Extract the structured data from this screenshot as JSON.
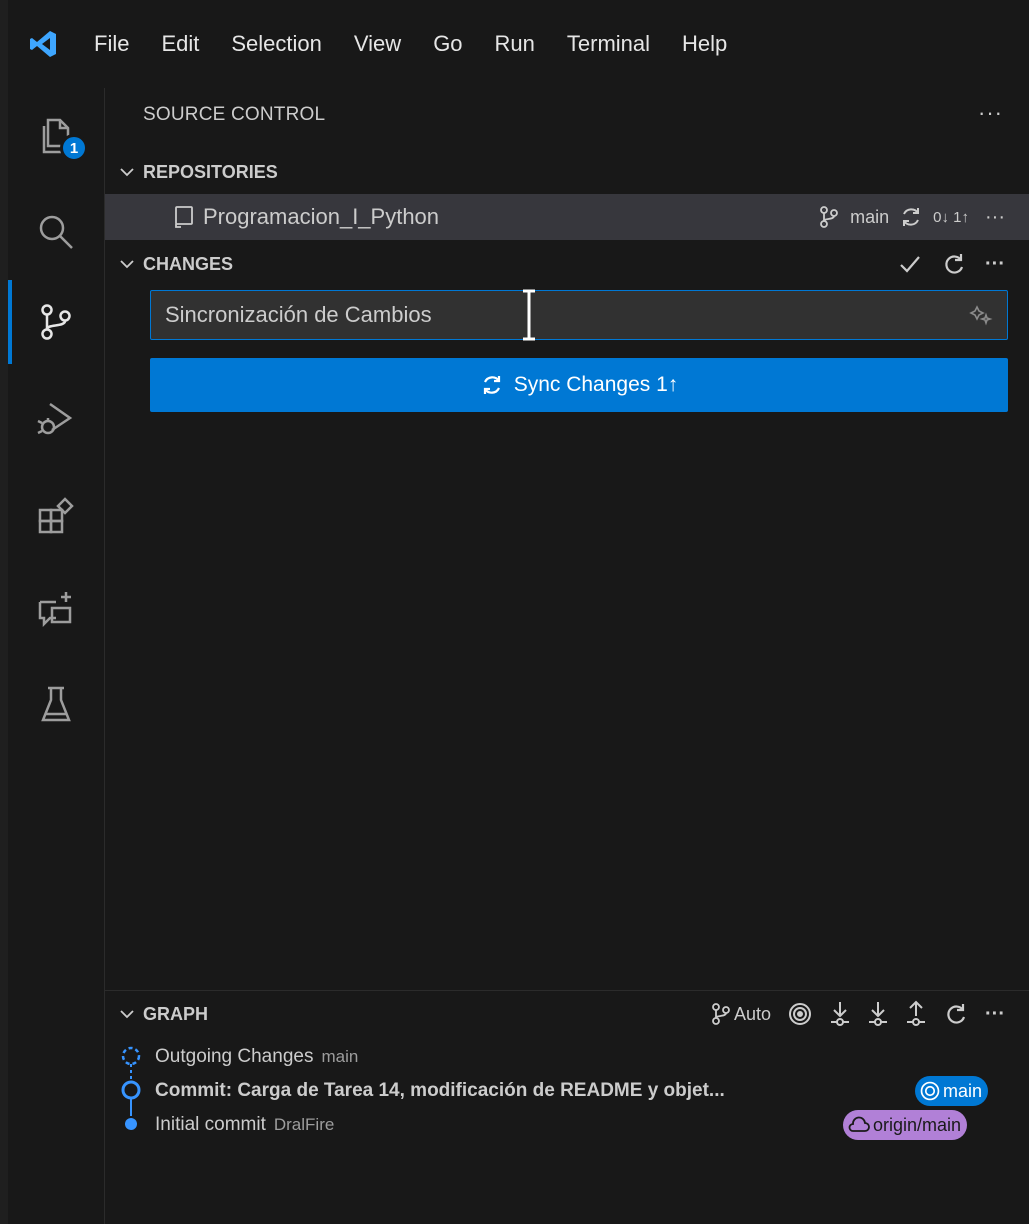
{
  "menu": [
    "File",
    "Edit",
    "Selection",
    "View",
    "Go",
    "Run",
    "Terminal",
    "Help"
  ],
  "activity": {
    "explorer_badge": "1"
  },
  "sidebar": {
    "title": "SOURCE CONTROL",
    "more": "···",
    "repositories": {
      "label": "REPOSITORIES",
      "repo_name": "Programacion_I_Python",
      "branch": "main",
      "sync_status": "0↓ 1↑"
    },
    "changes": {
      "label": "CHANGES",
      "commit_message": "Sincronización de Cambios",
      "sync_button": "Sync Changes 1↑"
    },
    "graph": {
      "label": "GRAPH",
      "branch_mode": "Auto",
      "rows": [
        {
          "title": "Outgoing Changes",
          "meta": "main"
        },
        {
          "title": "Commit: Carga de Tarea 14, modificación de README y objet...",
          "meta": ""
        },
        {
          "title": "Initial commit",
          "meta": "DralFire"
        }
      ],
      "pills": {
        "local": "main",
        "remote": "origin/main"
      }
    }
  },
  "colors": {
    "accent": "#0078d4",
    "remote_pill": "#b180d7",
    "selected_row": "#37373d"
  }
}
